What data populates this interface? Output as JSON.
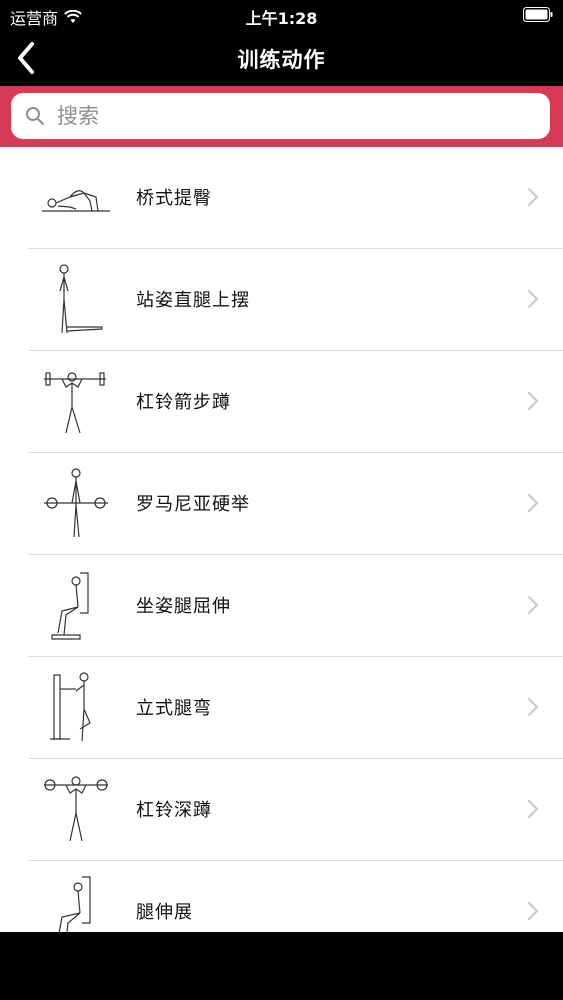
{
  "status_bar": {
    "carrier": "运营商",
    "time": "上午1:28"
  },
  "nav": {
    "title": "训练动作"
  },
  "search": {
    "placeholder": "搜索",
    "value": ""
  },
  "colors": {
    "accent": "#d63a56",
    "nav_bg": "#000000"
  },
  "exercises": [
    {
      "label": "桥式提臀",
      "icon": "glute-bridge-figure-icon"
    },
    {
      "label": "站姿直腿上摆",
      "icon": "standing-leg-raise-figure-icon"
    },
    {
      "label": "杠铃箭步蹲",
      "icon": "barbell-lunge-figure-icon"
    },
    {
      "label": "罗马尼亚硬举",
      "icon": "romanian-deadlift-figure-icon"
    },
    {
      "label": "坐姿腿屈伸",
      "icon": "seated-leg-extension-figure-icon"
    },
    {
      "label": "立式腿弯",
      "icon": "standing-leg-curl-figure-icon"
    },
    {
      "label": "杠铃深蹲",
      "icon": "barbell-squat-figure-icon"
    },
    {
      "label": "腿伸展",
      "icon": "leg-extension-figure-icon"
    }
  ]
}
